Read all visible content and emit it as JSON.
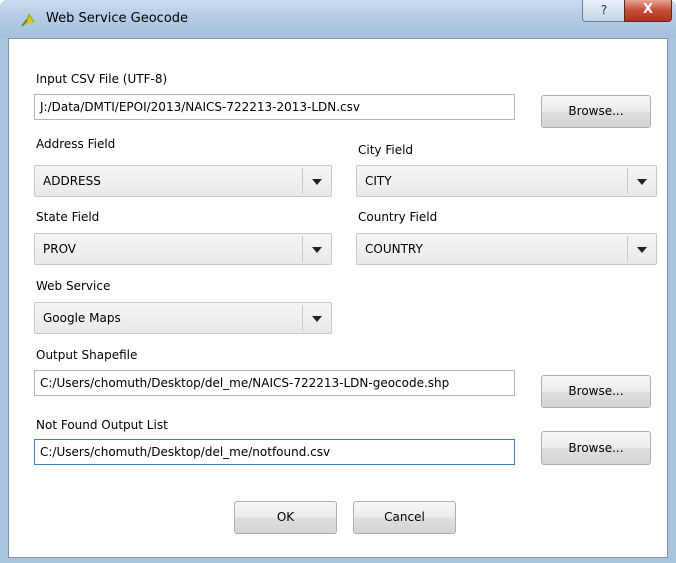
{
  "window": {
    "title": "Web Service Geocode",
    "help_label": "?",
    "close_label": "X"
  },
  "form": {
    "input_csv": {
      "label": "Input CSV File (UTF-8)",
      "value": "J:/Data/DMTI/EPOI/2013/NAICS-722213-2013-LDN.csv",
      "browse": "Browse..."
    },
    "address_field": {
      "label": "Address Field",
      "value": "ADDRESS"
    },
    "city_field": {
      "label": "City Field",
      "value": "CITY"
    },
    "state_field": {
      "label": "State Field",
      "value": "PROV"
    },
    "country_field": {
      "label": "Country Field",
      "value": "COUNTRY"
    },
    "web_service": {
      "label": "Web Service",
      "value": "Google Maps"
    },
    "output_shapefile": {
      "label": "Output Shapefile",
      "value": "C:/Users/chomuth/Desktop/del_me/NAICS-722213-LDN-geocode.shp",
      "browse": "Browse..."
    },
    "not_found": {
      "label": "Not Found Output List",
      "value": "C:/Users/chomuth/Desktop/del_me/notfound.csv",
      "browse": "Browse..."
    }
  },
  "buttons": {
    "ok": "OK",
    "cancel": "Cancel"
  }
}
